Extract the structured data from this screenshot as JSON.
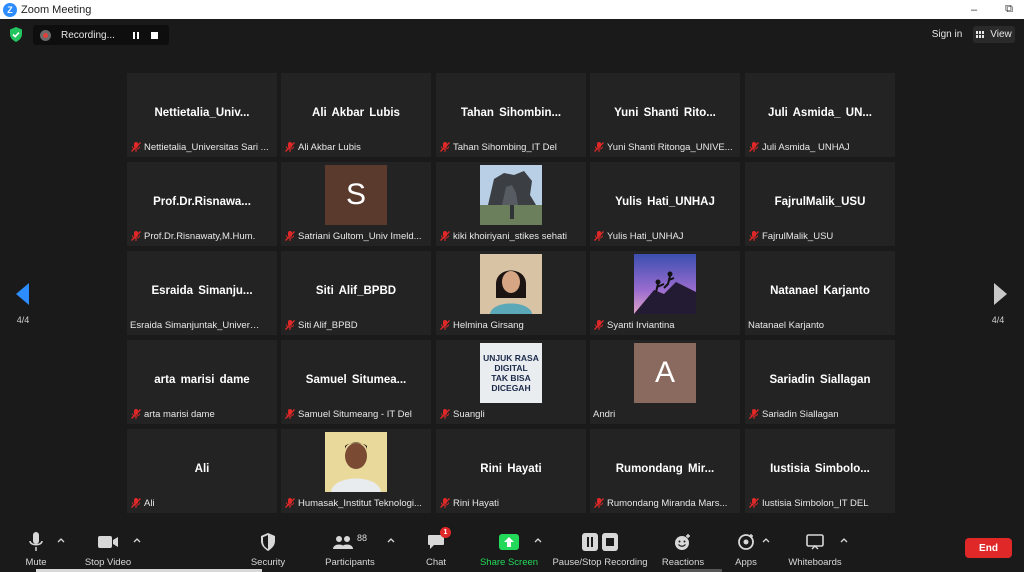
{
  "window": {
    "title": "Zoom Meeting"
  },
  "top_bar": {
    "recording_label": "Recording...",
    "sign_in_label": "Sign in",
    "view_label": "View"
  },
  "pagination": {
    "left": "4/4",
    "right": "4/4"
  },
  "participants": [
    {
      "name": "Nettietalia_Univ...",
      "label": "Nettietalia_Universitas Sari ...",
      "muted": true
    },
    {
      "name": "Ali Akbar Lubis",
      "label": "Ali Akbar Lubis",
      "muted": true
    },
    {
      "name": "Tahan  Sihombin...",
      "label": "Tahan Sihombing_IT Del",
      "muted": true
    },
    {
      "name": "Yuni  Shanti  Rito...",
      "label": "Yuni Shanti Ritonga_UNIVE...",
      "muted": true
    },
    {
      "name": "Juli  Asmida_  UN...",
      "label": "Juli Asmida_ UNHAJ",
      "muted": true
    },
    {
      "name": "Prof.Dr.Risnawa...",
      "label": "Prof.Dr.Risnawaty,M.Hum.",
      "muted": true
    },
    {
      "name": "S",
      "label": "Satriani Gultom_Univ Imeld...",
      "muted": true,
      "avatar": "letter",
      "avatar_color": "#5b3a2e"
    },
    {
      "name": "",
      "label": "kiki khoiriyani_stikes sehati",
      "muted": true,
      "avatar": "photo-statue"
    },
    {
      "name": "Yulis Hati_UNHAJ",
      "label": "Yulis Hati_UNHAJ",
      "muted": true
    },
    {
      "name": "FajrulMalik_USU",
      "label": "FajrulMalik_USU",
      "muted": true
    },
    {
      "name": "Esraida  Simanju...",
      "label": "Esraida Simanjuntak_Universit...",
      "muted": false
    },
    {
      "name": "Siti Alif_BPBD",
      "label": "Siti Alif_BPBD",
      "muted": true
    },
    {
      "name": "",
      "label": "Helmina Girsang",
      "muted": true,
      "avatar": "photo-woman"
    },
    {
      "name": "",
      "label": "Syanti Irviantina",
      "muted": true,
      "avatar": "photo-climb"
    },
    {
      "name": "Natanael Karjanto",
      "label": "Natanael Karjanto",
      "muted": false
    },
    {
      "name": "arta marisi dame",
      "label": "arta marisi dame",
      "muted": true
    },
    {
      "name": "Samuel  Situmea...",
      "label": "Samuel Situmeang - IT Del",
      "muted": true
    },
    {
      "name": "",
      "label": "Suangli",
      "muted": true,
      "avatar": "poster",
      "poster_text": [
        "UNJUK RASA",
        "DIGITAL",
        "TAK BISA",
        "DICEGAH"
      ]
    },
    {
      "name": "A",
      "label": "Andri",
      "muted": false,
      "avatar": "letter",
      "avatar_color": "#8a6a5e"
    },
    {
      "name": "Sariadin Siallagan",
      "label": "Sariadin Siallagan",
      "muted": true
    },
    {
      "name": "Ali",
      "label": "Ali",
      "muted": true
    },
    {
      "name": "",
      "label": "Humasak_Institut Teknologi...",
      "muted": true,
      "avatar": "photo-man"
    },
    {
      "name": "Rini Hayati",
      "label": "Rini Hayati",
      "muted": true
    },
    {
      "name": "Rumondang  Mir...",
      "label": "Rumondang Miranda Mars...",
      "muted": true
    },
    {
      "name": "Iustisia  Simbolo...",
      "label": "Iustisia Simbolon_IT DEL",
      "muted": true
    }
  ],
  "toolbar": {
    "mute": "Mute",
    "stop_video": "Stop Video",
    "security": "Security",
    "participants": "Participants",
    "participants_count": "88",
    "chat": "Chat",
    "chat_badge": "1",
    "share_screen": "Share Screen",
    "pause_stop_recording": "Pause/Stop Recording",
    "reactions": "Reactions",
    "apps": "Apps",
    "whiteboards": "Whiteboards",
    "end": "End"
  },
  "colors": {
    "background": "#1a1a1a",
    "tile": "#232323",
    "accent_blue": "#2d8cff",
    "muted_red": "#e02828",
    "share_green": "#23d959",
    "end_red": "#e02828"
  }
}
